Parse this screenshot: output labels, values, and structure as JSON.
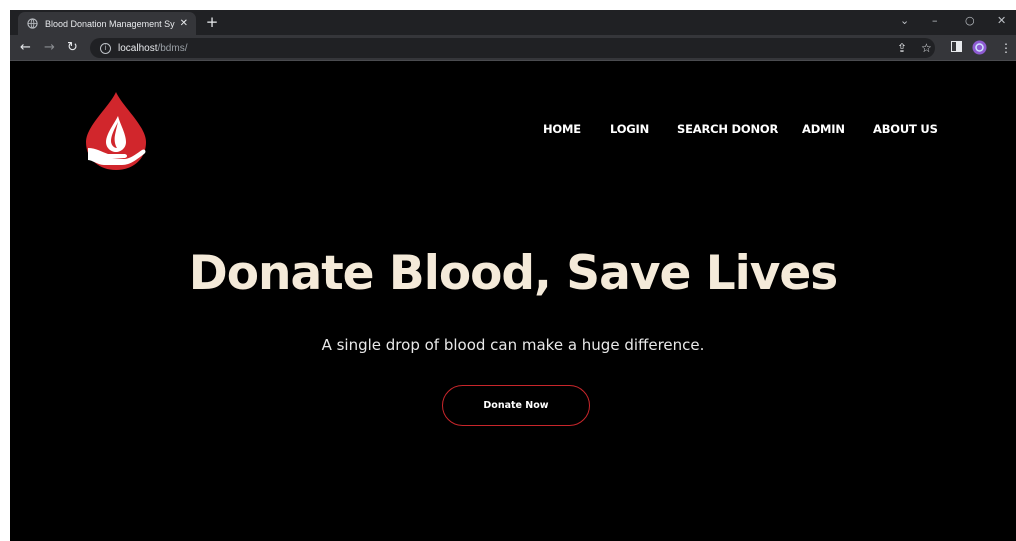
{
  "browser": {
    "tab_title": "Blood Donation Management Sy",
    "tab_close": "✕",
    "new_tab": "+",
    "url_host": "localhost",
    "url_path": "/bdms/",
    "controls": {
      "collapse": "⌄",
      "minimize": "–",
      "restore": "○",
      "close": "✕"
    },
    "icons": [
      "back-icon",
      "forward-icon",
      "reload-icon",
      "info-icon",
      "share-icon",
      "star-icon",
      "sidebar-icon",
      "profile-icon",
      "menu-icon"
    ]
  },
  "site": {
    "nav": [
      {
        "label": "HOME"
      },
      {
        "label": "LOGIN"
      },
      {
        "label": "SEARCH DONOR"
      },
      {
        "label": "ADMIN"
      },
      {
        "label": "ABOUT US"
      }
    ],
    "hero_title": "Donate Blood, Save Lives",
    "hero_subtitle": "A single drop of blood can make a huge difference.",
    "cta_label": "Donate Now",
    "colors": {
      "accent": "#c8262b",
      "title": "#f4ead9",
      "background": "#000000"
    }
  }
}
